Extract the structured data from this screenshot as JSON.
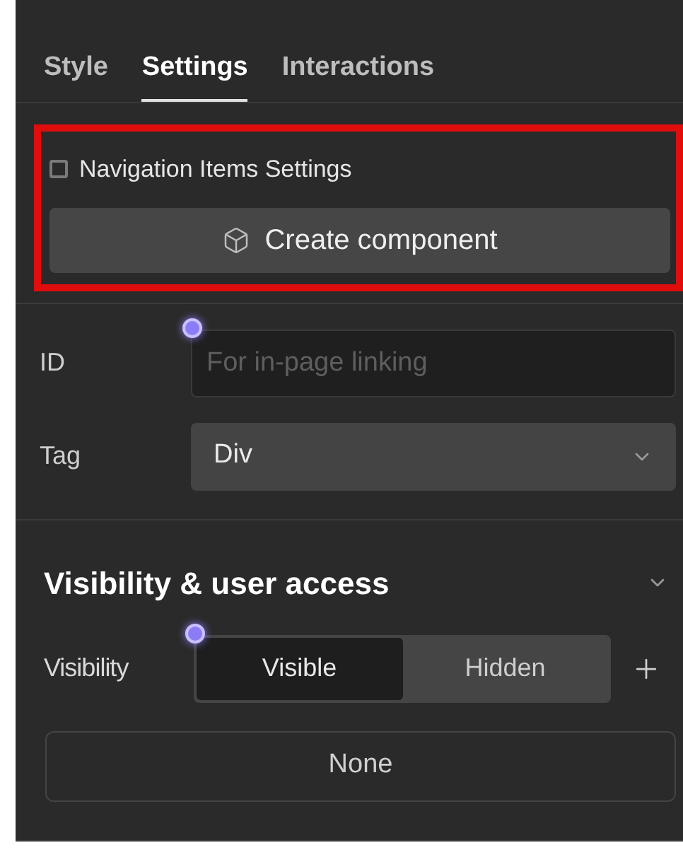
{
  "tabs": [
    {
      "label": "Style",
      "selected": false
    },
    {
      "label": "Settings",
      "selected": true
    },
    {
      "label": "Interactions",
      "selected": false
    }
  ],
  "component_box": {
    "checkbox": {
      "label": "Navigation Items Settings",
      "checked": false
    },
    "button": "Create component"
  },
  "fields": [
    {
      "kind": "input",
      "label": "ID",
      "placeholder": "For in-page linking"
    },
    {
      "kind": "select",
      "label": "Tag",
      "value": "Div"
    }
  ],
  "visibility_section": {
    "title": "Visibility & user access",
    "expanded": true,
    "label": "Visibility",
    "options": [
      {
        "label": "Visible",
        "selected": true
      },
      {
        "label": "Hidden",
        "selected": false
      }
    ],
    "button": "None"
  }
}
